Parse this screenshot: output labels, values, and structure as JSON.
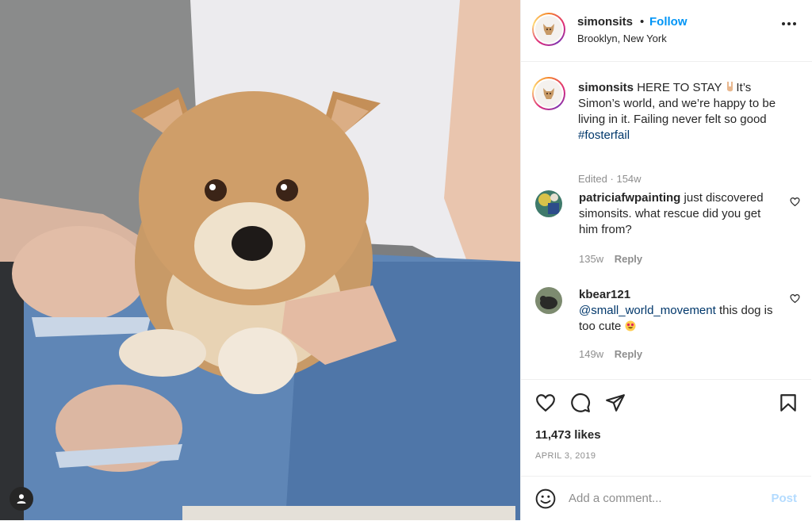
{
  "post": {
    "username": "simonsits",
    "separator": "•",
    "follow_label": "Follow",
    "location": "Brooklyn, New York"
  },
  "caption": {
    "username": "simonsits",
    "text_1": "HERE TO STAY",
    "text_2": "It’s Simon’s world, and we’re happy to be living in it. Failing never felt so good",
    "hashtag": "#fosterfail",
    "edited": "Edited",
    "dot": "·",
    "age": "154w"
  },
  "comments": [
    {
      "username": "patriciafwpainting",
      "text": "just discovered simonsits. what rescue did you get him from?",
      "age": "135w",
      "reply_label": "Reply"
    },
    {
      "username": "kbear121",
      "mention": "@small_world_movement",
      "text": "this dog is too cute",
      "age": "149w",
      "reply_label": "Reply"
    }
  ],
  "stats": {
    "likes": "11,473 likes",
    "date": "APRIL 3, 2019"
  },
  "composer": {
    "placeholder": "Add a comment...",
    "post_label": "Post"
  },
  "icons": [
    "heart-icon",
    "comment-icon",
    "share-icon",
    "bookmark-icon",
    "more-icon",
    "emoji-icon",
    "user-tag-icon",
    "rock-on-hand-emoji",
    "heart-eyes-emoji"
  ],
  "colors": {
    "link_blue": "#0095f6",
    "hashtag_blue": "#00376b",
    "muted": "#8e8e8e",
    "post_disabled": "#b3dbff"
  }
}
